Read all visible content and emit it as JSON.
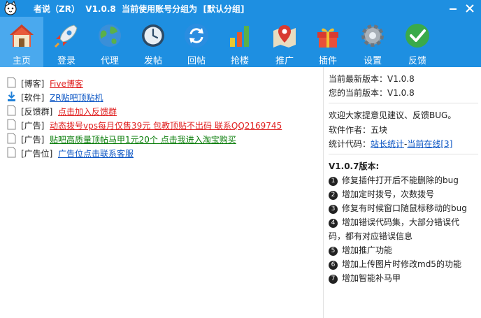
{
  "window": {
    "title": "者说（ZR）  V1.0.8  当前使用账号分组为  [默认分组]",
    "min_icon": "minimize-icon",
    "close_icon": "close-icon"
  },
  "colors": {
    "titlebar": "#1e8fe1",
    "active_tab": "#4aa9ee",
    "red_link": "#e02020",
    "blue_link": "#0b55c4",
    "green_link": "#0a7d0a"
  },
  "toolbar": [
    {
      "label": "主页",
      "icon": "home-icon",
      "active": true
    },
    {
      "label": "登录",
      "icon": "rocket-icon",
      "active": false
    },
    {
      "label": "代理",
      "icon": "globe-icon",
      "active": false
    },
    {
      "label": "发帖",
      "icon": "clock-icon",
      "active": false
    },
    {
      "label": "回帖",
      "icon": "refresh-icon",
      "active": false
    },
    {
      "label": "抢楼",
      "icon": "bar-chart-icon",
      "active": false
    },
    {
      "label": "推广",
      "icon": "map-pin-icon",
      "active": false
    },
    {
      "label": "插件",
      "icon": "gift-icon",
      "active": false
    },
    {
      "label": "设置",
      "icon": "gear-icon",
      "active": false
    },
    {
      "label": "反馈",
      "icon": "checkmark-icon",
      "active": false
    }
  ],
  "links": [
    {
      "tag": "[博客]",
      "text": "Five博客",
      "color": "red",
      "icon": "file-icon"
    },
    {
      "tag": "[软件]",
      "text": "ZR贴吧顶贴机",
      "color": "blue",
      "icon": "download-icon"
    },
    {
      "tag": "[反馈群]",
      "text": "点击加入反馈群",
      "color": "red",
      "icon": "file-icon"
    },
    {
      "tag": "[广告]",
      "text": "动态拨号vps每月仅售39元 包教顶贴不出码 联系QQ2169745",
      "color": "red",
      "icon": "file-icon"
    },
    {
      "tag": "[广告]",
      "text": "贴吧高质量顶帖马甲1元20个 点击我进入淘宝购买",
      "color": "green",
      "icon": "file-icon"
    },
    {
      "tag": "[广告位]",
      "text": "广告位点击联系客服",
      "color": "blue",
      "icon": "file-icon"
    }
  ],
  "info": {
    "latest_version": "当前最新版本：V1.0.8",
    "current_version": "您的当前版本：V1.0.8",
    "welcome": "欢迎大家提意见建议、反馈BUG。",
    "author": "软件作者：五块",
    "stats_label": "统计代码：",
    "stats_link1": "站长统计",
    "stats_sep": "-",
    "stats_link2": "当前在线[3]"
  },
  "changelog": {
    "title": "V1.0.7版本:",
    "items": [
      {
        "n": "1",
        "text": "修复插件打开后不能删除的bug"
      },
      {
        "n": "2",
        "text": "增加定时拨号，次数拨号"
      },
      {
        "n": "3",
        "text": "修复有时候窗口随鼠标移动的bug"
      },
      {
        "n": "4",
        "text": "增加错误代码集，大部分错误代"
      },
      {
        "n": "",
        "text": "码，都有对应错误信息"
      },
      {
        "n": "5",
        "text": "增加推广功能"
      },
      {
        "n": "6",
        "text": "增加上传图片时修改md5的功能"
      },
      {
        "n": "7",
        "text": "增加智能补马甲"
      }
    ]
  }
}
